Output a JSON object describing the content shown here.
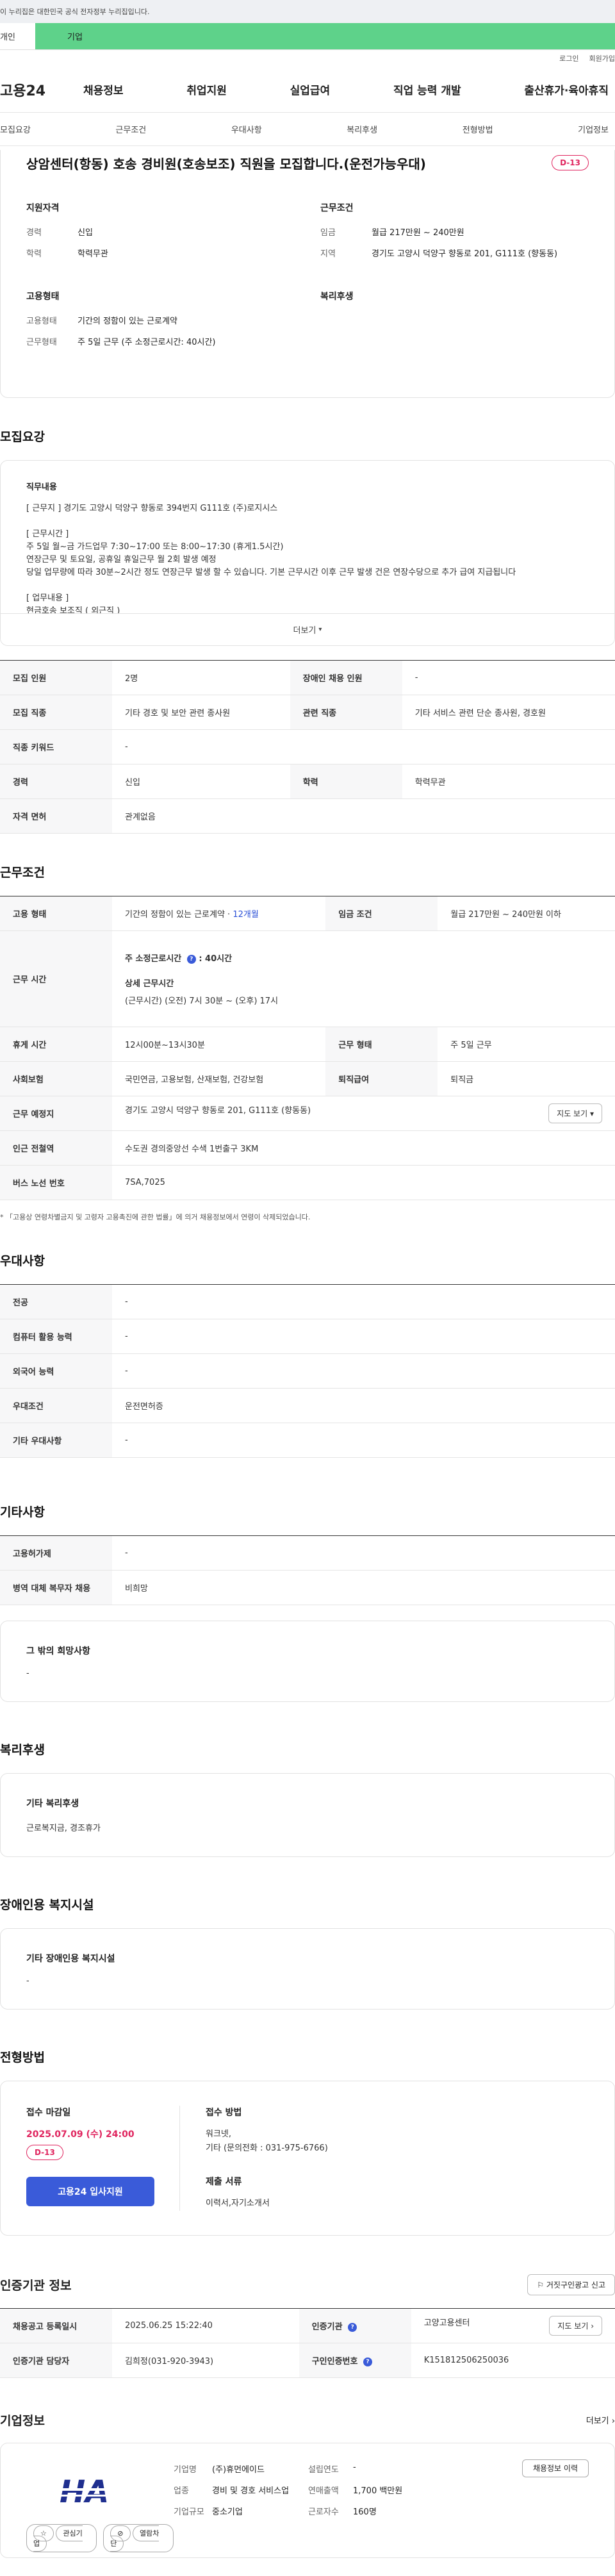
{
  "gov_bar": {
    "text": "이 누리집은 대한민국 공식 전자정부 누리집입니다."
  },
  "top_tabs": {
    "individual": "개인",
    "business": "기업"
  },
  "util": {
    "login": "로그인",
    "signup": "회원가입"
  },
  "gnb": {
    "logo": "고용24",
    "menu": [
      "채용정보",
      "취업지원",
      "실업급여",
      "직업 능력 개발",
      "출산휴가·육아휴직"
    ]
  },
  "subnav": [
    "모집요강",
    "근무조건",
    "우대사항",
    "복리후생",
    "전형방법",
    "기업정보"
  ],
  "job": {
    "title": "상암센터(항동) 호송 경비원(호송보조) 직원을 모집합니다.(운전가능우대)",
    "dday": "D-13",
    "summary": {
      "qual_title": "지원자격",
      "career_k": "경력",
      "career_v": "신입",
      "edu_k": "학력",
      "edu_v": "학력무관",
      "cond_title": "근무조건",
      "wage_k": "임금",
      "wage_v": "월급 217만원 ~ 240만원",
      "region_k": "지역",
      "region_v": "경기도 고양시 덕양구 향동로 201, G111호 (향동동)",
      "emp_title": "고용형태",
      "emptype_k": "고용형태",
      "emptype_v": "기간의 정함이 있는 근로계약",
      "worktype_k": "근무형태",
      "worktype_v": "주 5일 근무 (주 소정근로시간: 40시간)",
      "welfare_title": "복리후생"
    }
  },
  "recruit": {
    "title": "모집요강",
    "duty_title": "직무내용",
    "duty_lines": [
      "[ 근무지 ] 경기도 고양시 덕양구 향동로 394번지 G111호 (주)로지시스",
      "",
      "[ 근무시간 ]",
      "주 5일 월~금 가드업무 7:30~17:00 또는 8:00~17:30 (휴게1.5시간)",
      "연장근무 및 토요일, 공휴일 휴일근무 월 2회 발생 예정",
      "당일 업무량에 따라 30분~2시간 정도 연장근무 발생 할 수 있습니다. 기본 근무시간 이후 근무 발생 건은 연장수당으로 추가 급여 지급됩니다",
      "",
      "[ 업무내용 ]",
      "현금호송 보조직 ( 외근직 )"
    ],
    "more": "더보기",
    "rows": [
      {
        "k1": "모집 인원",
        "v1": "2명",
        "k2": "장애인 채용 인원",
        "v2": "-"
      },
      {
        "k1": "모집 직종",
        "v1": "기타 경호 및 보안 관련 종사원",
        "k2": "관련 직종",
        "v2": "기타 서비스 관련 단순 종사원, 경호원"
      },
      {
        "k1": "직종 키워드",
        "v1": "-"
      },
      {
        "k1": "경력",
        "v1": "신입",
        "k2": "학력",
        "v2": "학력무관"
      },
      {
        "k1": "자격 면허",
        "v1": "관계없음"
      }
    ]
  },
  "work": {
    "title": "근무조건",
    "emp_k": "고용 형태",
    "emp_v": "기간의 정함이 있는 근로계약 ·",
    "emp_months": "12개월",
    "wage_k": "임금 조건",
    "wage_v": "월급 217만원 ~ 240만원 이하",
    "time_k": "근무 시간",
    "time_line1": "주 소정근로시간",
    "time_line1_v": ": 40시간",
    "time_detail_title": "상세 근무시간",
    "time_detail": "(근무시간) (오전) 7시 30분 ~ (오후) 17시",
    "rest_k": "휴게 시간",
    "rest_v": "12시00분~13시30분",
    "form_k": "근무 형태",
    "form_v": "주 5일 근무",
    "ins_k": "사회보험",
    "ins_v": "국민연금, 고용보험, 산재보험, 건강보험",
    "retire_k": "퇴직급여",
    "retire_v": "퇴직금",
    "place_k": "근무 예정지",
    "place_v": "경기도 고양시 덕양구 향동로 201, G111호 (향동동)",
    "map_btn": "지도 보기",
    "subway_k": "인근 전철역",
    "subway_v": "수도권 경의중앙선 수색 1번출구 3KM",
    "bus_k": "버스 노선 번호",
    "bus_v": "7SA,7025",
    "note": "* 「고용상 연령차별금지 및 고령자 고용촉진에 관한 법률」에 의거 채용정보에서 연령이 삭제되었습니다."
  },
  "pref": {
    "title": "우대사항",
    "rows": [
      {
        "k": "전공",
        "v": "-"
      },
      {
        "k": "컴퓨터 활용 능력",
        "v": "-"
      },
      {
        "k": "외국어 능력",
        "v": "-"
      },
      {
        "k": "우대조건",
        "v": "운전면허증"
      },
      {
        "k": "기타 우대사항",
        "v": "-"
      }
    ]
  },
  "etc": {
    "title": "기타사항",
    "rows": [
      {
        "k": "고용허가제",
        "v": "-"
      },
      {
        "k": "병역 대체 복무자 채용",
        "v": "비희망"
      }
    ],
    "hope_title": "그 밖의 희망사항",
    "hope_v": "-"
  },
  "welfare": {
    "title": "복리후생",
    "sub": "기타 복리후생",
    "v": "근로복지금, 경조휴가"
  },
  "disabled": {
    "title": "장애인용 복지시설",
    "sub": "기타 장애인용 복지시설",
    "v": "-"
  },
  "apply": {
    "title": "전형방법",
    "deadline_title": "접수 마감일",
    "deadline": "2025.07.09 (수) 24:00",
    "dday": "D-13",
    "btn": "고용24 입사지원",
    "method_title": "접수 방법",
    "method_1": "워크넷,",
    "method_2": "기타 (문의전화 : 031-975-6766)",
    "docs_title": "제출 서류",
    "docs": "이력서,자기소개서"
  },
  "cert": {
    "title": "인증기관 정보",
    "report_btn": "거짓구인광고 신고",
    "reg_k": "채용공고 등록일시",
    "reg_v": "2025.06.25 15:22:40",
    "org_k": "인증기관",
    "org_v": "고양고용센터",
    "map_btn": "지도 보기",
    "mgr_k": "인증기관 담당자",
    "mgr_v": "김희정(031-920-3943)",
    "cert_k": "구인인증번호",
    "cert_v": "K151812506250036"
  },
  "company": {
    "title": "기업정보",
    "more": "더보기",
    "logo_text": "HA",
    "fav_btn": "관심기업",
    "block_btn": "열람차단",
    "name_k": "기업명",
    "name_v": "(주)휴먼에이드",
    "year_k": "설립연도",
    "year_v": "-",
    "ind_k": "업종",
    "ind_v": "경비 및 경호 서비스업",
    "sales_k": "연매출액",
    "sales_v": "1,700 백만원",
    "size_k": "기업규모",
    "size_v": "중소기업",
    "staff_k": "근로자수",
    "staff_v": "160명",
    "biz_btn": "채용정보 이력"
  }
}
